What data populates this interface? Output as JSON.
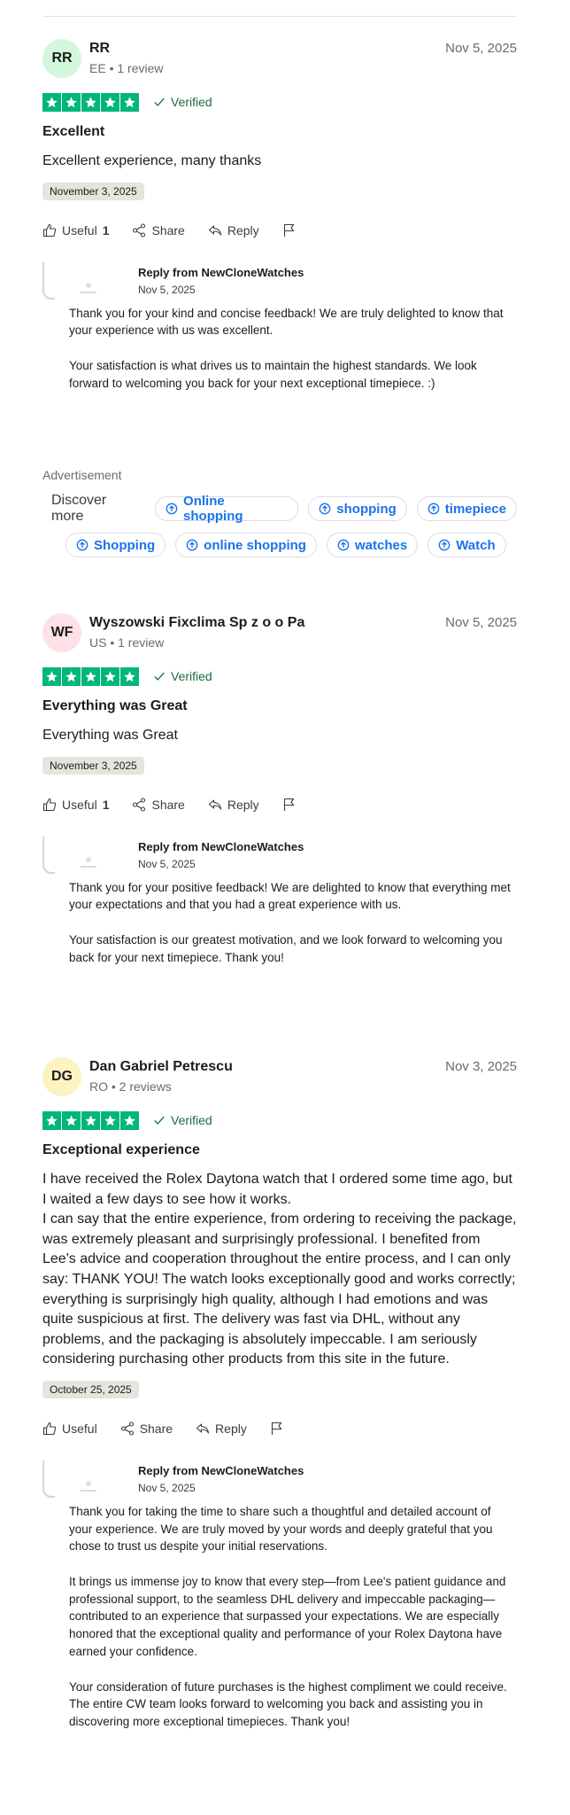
{
  "reviews": [
    {
      "initials": "RR",
      "avatar_color": "#d4f7dc",
      "name": "RR",
      "meta": "EE • 1 review",
      "date": "Nov 5, 2025",
      "verified": "Verified",
      "title": "Excellent",
      "body": "Excellent experience, many thanks",
      "experience_date": "November 3, 2025",
      "useful_label": "Useful",
      "useful_count": "1",
      "share_label": "Share",
      "reply_label": "Reply",
      "reply": {
        "from": "Reply from NewCloneWatches",
        "date": "Nov 5, 2025",
        "paragraphs": [
          "Thank you for your kind and concise feedback! We are truly delighted to know that your experience with us was excellent.",
          "Your satisfaction is what drives us to maintain the highest standards. We look forward to welcoming you back for your next exceptional timepiece. :)"
        ]
      }
    },
    {
      "initials": "WF",
      "avatar_color": "#fde1e7",
      "name": "Wyszowski Fixclima Sp z o o Pa",
      "meta": "US • 1 review",
      "date": "Nov 5, 2025",
      "verified": "Verified",
      "title": "Everything was Great",
      "body": "Everything was Great",
      "experience_date": "November 3, 2025",
      "useful_label": "Useful",
      "useful_count": "1",
      "share_label": "Share",
      "reply_label": "Reply",
      "reply": {
        "from": "Reply from NewCloneWatches",
        "date": "Nov 5, 2025",
        "paragraphs": [
          "Thank you for your positive feedback! We are delighted to know that everything met your expectations and that you had a great experience with us.",
          "Your satisfaction is our greatest motivation, and we look forward to welcoming you back for your next timepiece. Thank you!"
        ]
      }
    },
    {
      "initials": "DG",
      "avatar_color": "#fdf3c0",
      "name": "Dan Gabriel Petrescu",
      "meta": "RO • 2 reviews",
      "date": "Nov 3, 2025",
      "verified": "Verified",
      "title": "Exceptional experience",
      "body": "I have received the Rolex Daytona watch that I ordered some time ago, but I waited a few days to see how it works.\nI can say that the entire experience, from ordering to receiving the package, was extremely pleasant and surprisingly professional. I benefited from Lee's advice and cooperation throughout the entire process, and I can only say: THANK YOU! The watch looks exceptionally good and works correctly; everything is surprisingly high quality, although I had emotions and was quite suspicious at first. The delivery was fast via DHL, without any problems, and the packaging is absolutely impeccable. I am seriously considering purchasing other products from this site in the future.",
      "experience_date": "October 25, 2025",
      "useful_label": "Useful",
      "useful_count": "",
      "share_label": "Share",
      "reply_label": "Reply",
      "reply": {
        "from": "Reply from NewCloneWatches",
        "date": "Nov 5, 2025",
        "paragraphs": [
          "Thank you for taking the time to share such a thoughtful and detailed account of your experience. We are truly moved by your words and deeply grateful that you chose to trust us despite your initial reservations.",
          "It brings us immense joy to know that every step—from Lee's patient guidance and professional support, to the seamless DHL delivery and impeccable packaging—contributed to an experience that surpassed your expectations. We are especially honored that the exceptional quality and performance of your Rolex Daytona have earned your confidence.",
          "Your consideration of future purchases is the highest compliment we could receive. The entire CW team looks forward to welcoming you back and assisting you in discovering more exceptional timepieces. Thank you!"
        ]
      }
    }
  ],
  "ad": {
    "label": "Advertisement",
    "discover": "Discover more",
    "row1": [
      "Online shopping",
      "shopping",
      "timepiece"
    ],
    "row2": [
      "Shopping",
      "online shopping",
      "watches",
      "Watch"
    ]
  },
  "colors": {
    "star_green": "#00b67a",
    "verified_green": "#1c6b3f",
    "chip_blue": "#1a73e8"
  }
}
